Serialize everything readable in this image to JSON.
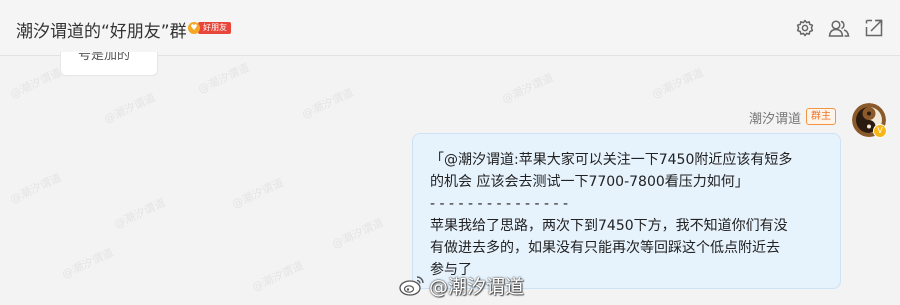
{
  "header": {
    "title": "潮汐谓道的“好朋友”群",
    "badge_heart": "♥",
    "badge_label": "好朋友",
    "icons": [
      "settings-icon",
      "members-icon",
      "share-icon"
    ]
  },
  "previous_message": {
    "partial_text": "号是加的"
  },
  "watermarks": [
    "@潮汐谓道",
    "@潮汐谓道",
    "@潮汐谓道",
    "@潮汐谓道",
    "@潮汐谓道",
    "@潮汐谓道",
    "@潮汐谓道",
    "@潮汐谓道",
    "@潮汐谓道",
    "@潮汐谓道",
    "@潮汐谓道",
    "@潮汐谓道"
  ],
  "message": {
    "sender": "潮汐谓道",
    "role_badge": "群主",
    "verified_mark": "V",
    "lines": [
      "「@潮汐谓道:苹果大家可以关注一下7450附近应该有短多",
      "的机会 应该会去测试一下7700-7800看压力如何」",
      "- - - - - - - - - - - - - - -",
      "苹果我给了思路，两次下到7450下方，我不知道你们有没",
      "有做进去多的，如果没有只能再次等回踩这个低点附近去",
      "参与了"
    ]
  },
  "site_watermark": {
    "text": "@潮汐谓道"
  },
  "colors": {
    "bubble_bg": "#e6f2fc",
    "owner_badge": "#e8762c",
    "group_badge": "#e8463a"
  }
}
